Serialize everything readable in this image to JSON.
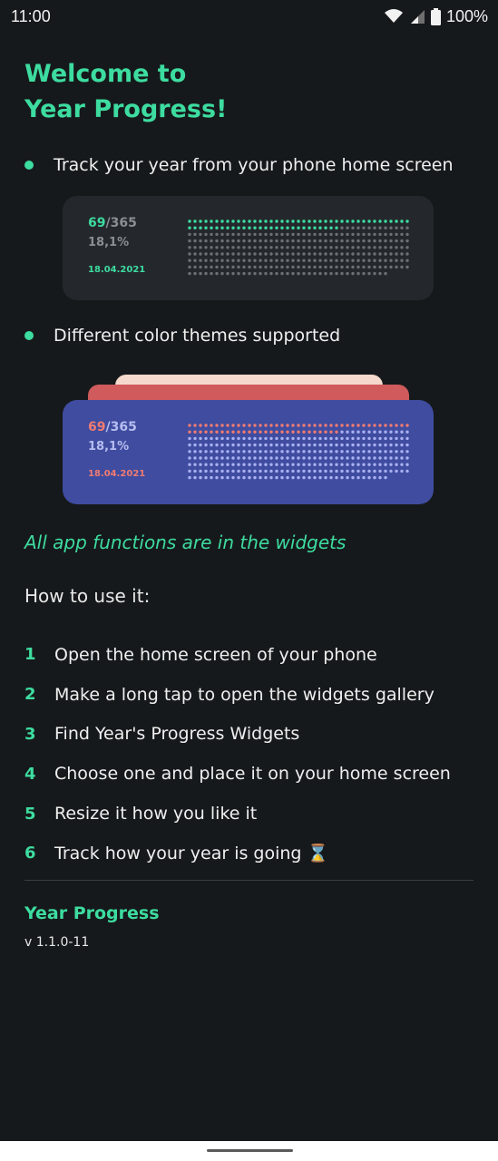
{
  "status_bar": {
    "time": "11:00",
    "battery": "100%",
    "icons": [
      "wifi-icon",
      "signal-icon",
      "battery-icon"
    ]
  },
  "title": {
    "line1": "Welcome to",
    "line2": "Year Progress!"
  },
  "features": [
    {
      "text": "Track your year from your phone home screen"
    },
    {
      "text": "Different color themes supported"
    }
  ],
  "widgets": {
    "dark": {
      "day": "69",
      "total": "/365",
      "percent": "18,1%",
      "date": "18.04.2021",
      "progress": 0.189,
      "colors": {
        "bg": "#24282c",
        "day": "#3ddca0",
        "total": "#8a8f94",
        "percent": "#8a8f94",
        "date": "#3ddca0",
        "filled": "#3ddca0",
        "empty": "#6b7075"
      }
    },
    "blue": {
      "day": "69",
      "total": "/365",
      "percent": "18,1%",
      "date": "18.04.2021",
      "progress": 0.189,
      "colors": {
        "bg": "#3f4c9f",
        "day": "#f07b72",
        "total": "#b6bdf0",
        "percent": "#b6bdf0",
        "date": "#f07b72",
        "filled": "#f07b72",
        "empty": "#a9b0f2"
      }
    }
  },
  "tagline": "All app functions are in the widgets",
  "how_to": {
    "title": "How to use it:",
    "steps": [
      {
        "num": "1",
        "text": "Open the home screen of your phone"
      },
      {
        "num": "2",
        "text": "Make a long tap to open the widgets gallery"
      },
      {
        "num": "3",
        "text": "Find Year's Progress Widgets"
      },
      {
        "num": "4",
        "text": "Choose one and place it on your home screen"
      },
      {
        "num": "5",
        "text": "Resize it how you like it"
      },
      {
        "num": "6",
        "text": "Track how your year is going ⌛"
      }
    ]
  },
  "footer": {
    "app_name": "Year Progress",
    "version": "v 1.1.0-11"
  },
  "colors": {
    "accent": "#3ddca0",
    "background": "#16191b"
  }
}
